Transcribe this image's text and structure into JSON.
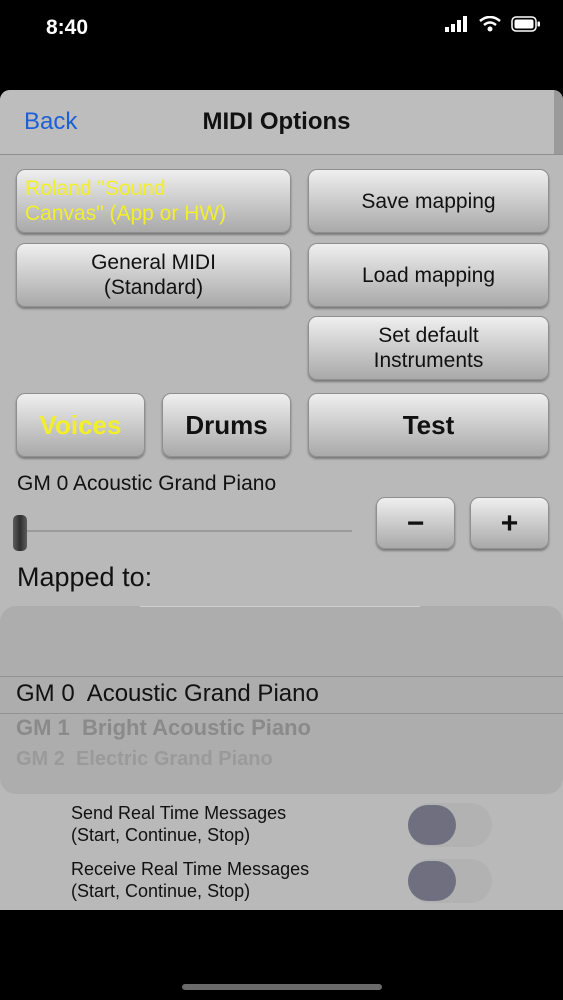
{
  "status_bar": {
    "time": "8:40"
  },
  "nav": {
    "back_label": "Back",
    "title": "MIDI Options"
  },
  "buttons": {
    "roland": "Roland \"Sound\nCanvas\" (App or HW)",
    "general_midi": "General MIDI\n(Standard)",
    "save_mapping": "Save mapping",
    "load_mapping": "Load mapping",
    "set_default": "Set default\nInstruments",
    "voices": "Voices",
    "drums": "Drums",
    "test": "Test",
    "minus": "−",
    "plus": "+"
  },
  "instrument": {
    "label": "GM 0  Acoustic Grand Piano",
    "slider_value": 0
  },
  "mapped_to_label": "Mapped to:",
  "picker": {
    "selected": "GM 0  Acoustic Grand Piano",
    "next": "GM 1  Bright Acoustic Piano",
    "next2": "GM 2  Electric Grand Piano"
  },
  "settings": {
    "send_realtime": {
      "label": "Send Real Time Messages\n(Start, Continue, Stop)",
      "on": false
    },
    "receive_realtime": {
      "label": "Receive Real Time Messages\n(Start, Continue, Stop)",
      "on": false
    }
  },
  "colors": {
    "accent_yellow": "#f2ef2a",
    "link_blue": "#1d5fd8",
    "panel_gray": "#b9b9b9"
  }
}
